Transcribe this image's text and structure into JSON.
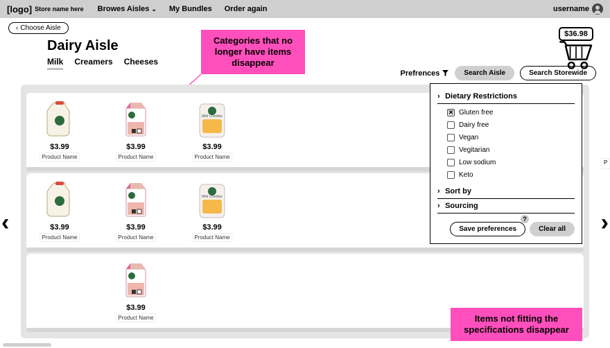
{
  "topbar": {
    "logo": "[logo]",
    "store_name": "Store name here",
    "nav": {
      "browse": "Browes Aisles",
      "bundles": "My Bundles",
      "order_again": "Order again"
    },
    "username": "username"
  },
  "choose_aisle": "Choose Aisle",
  "aisle": {
    "title": "Dairy Aisle",
    "categories": [
      "Milk",
      "Creamers",
      "Cheeses"
    ],
    "active_index": 0
  },
  "annotations": {
    "top": "Categories that no longer have items disappear",
    "bottom": "Items not fitting the specifications disappear"
  },
  "controls": {
    "preferences_label": "Prefrences",
    "search_aisle": "Search Aisle",
    "search_storewide": "Search Storewide"
  },
  "cart": {
    "total": "$36.98"
  },
  "shelves": [
    {
      "products": [
        {
          "icon": "jug",
          "price": "$3.99",
          "name": "Product Name"
        },
        {
          "icon": "carton",
          "price": "$3.99",
          "name": "Product Name"
        },
        {
          "icon": "cheese",
          "price": "$3.99",
          "name": "Product Name"
        }
      ]
    },
    {
      "products": [
        {
          "icon": "jug",
          "price": "$3.99",
          "name": "Product Name"
        },
        {
          "icon": "carton",
          "price": "$3.99",
          "name": "Product Name"
        },
        {
          "icon": "cheese",
          "price": "$3.99",
          "name": "Product Name"
        }
      ]
    },
    {
      "products": [
        {
          "icon": "carton",
          "price": "$3.99",
          "name": "Product Name"
        }
      ],
      "offset": 1
    }
  ],
  "preferences_panel": {
    "sections": {
      "dietary": {
        "title": "Dietary Restrictions",
        "options": [
          {
            "label": "Gluten free",
            "checked": true
          },
          {
            "label": "Dairy free",
            "checked": false
          },
          {
            "label": "Vegan",
            "checked": false
          },
          {
            "label": "Vegitarian",
            "checked": false
          },
          {
            "label": "Low sodium",
            "checked": false
          },
          {
            "label": "Keto",
            "checked": false
          }
        ]
      },
      "sort_by": "Sort by",
      "sourcing": "Sourcing"
    },
    "save": "Save preferences",
    "clear": "Clear all",
    "help": "?"
  },
  "peek": "P"
}
